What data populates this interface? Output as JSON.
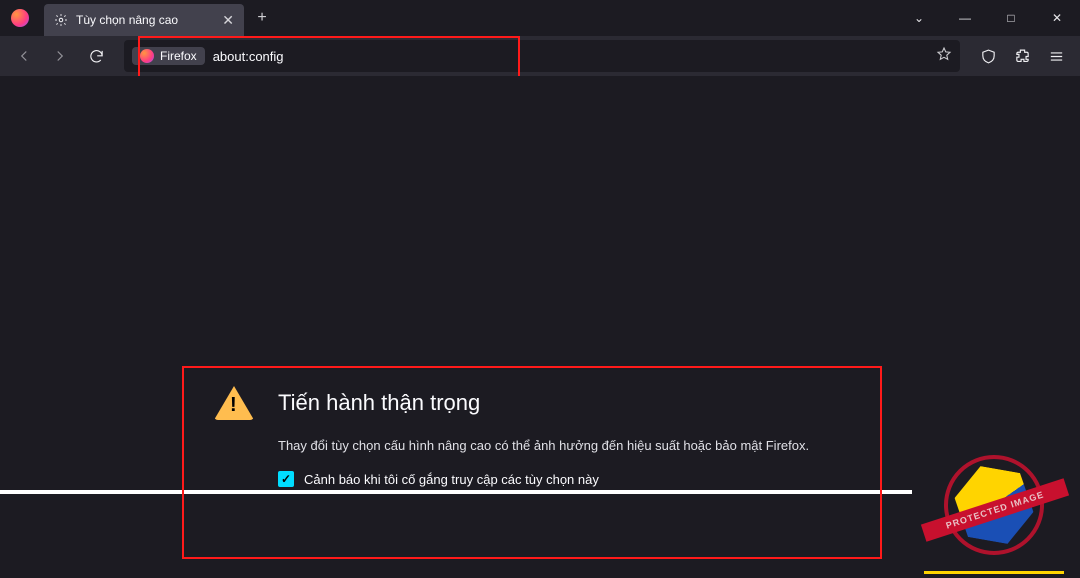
{
  "titlebar": {
    "tab_label": "Tùy chọn nâng cao",
    "newtab_tooltip": "+",
    "window": {
      "min": "—",
      "max": "□",
      "close": "✕",
      "caret": "⌄"
    }
  },
  "toolbar": {
    "urlbar": {
      "chip_label": "Firefox",
      "url": "about:config"
    }
  },
  "warning": {
    "title": "Tiến hành thận trọng",
    "description": "Thay đổi tùy chọn cấu hình nâng cao có thể ảnh hưởng đến hiệu suất hoặc bảo mật Firefox.",
    "checkbox_label": "Cảnh báo khi tôi cố gắng truy cập các tùy chọn này",
    "checkbox_checked": true
  },
  "watermark": {
    "band": "PROTECTED IMAGE",
    "caption": ""
  }
}
